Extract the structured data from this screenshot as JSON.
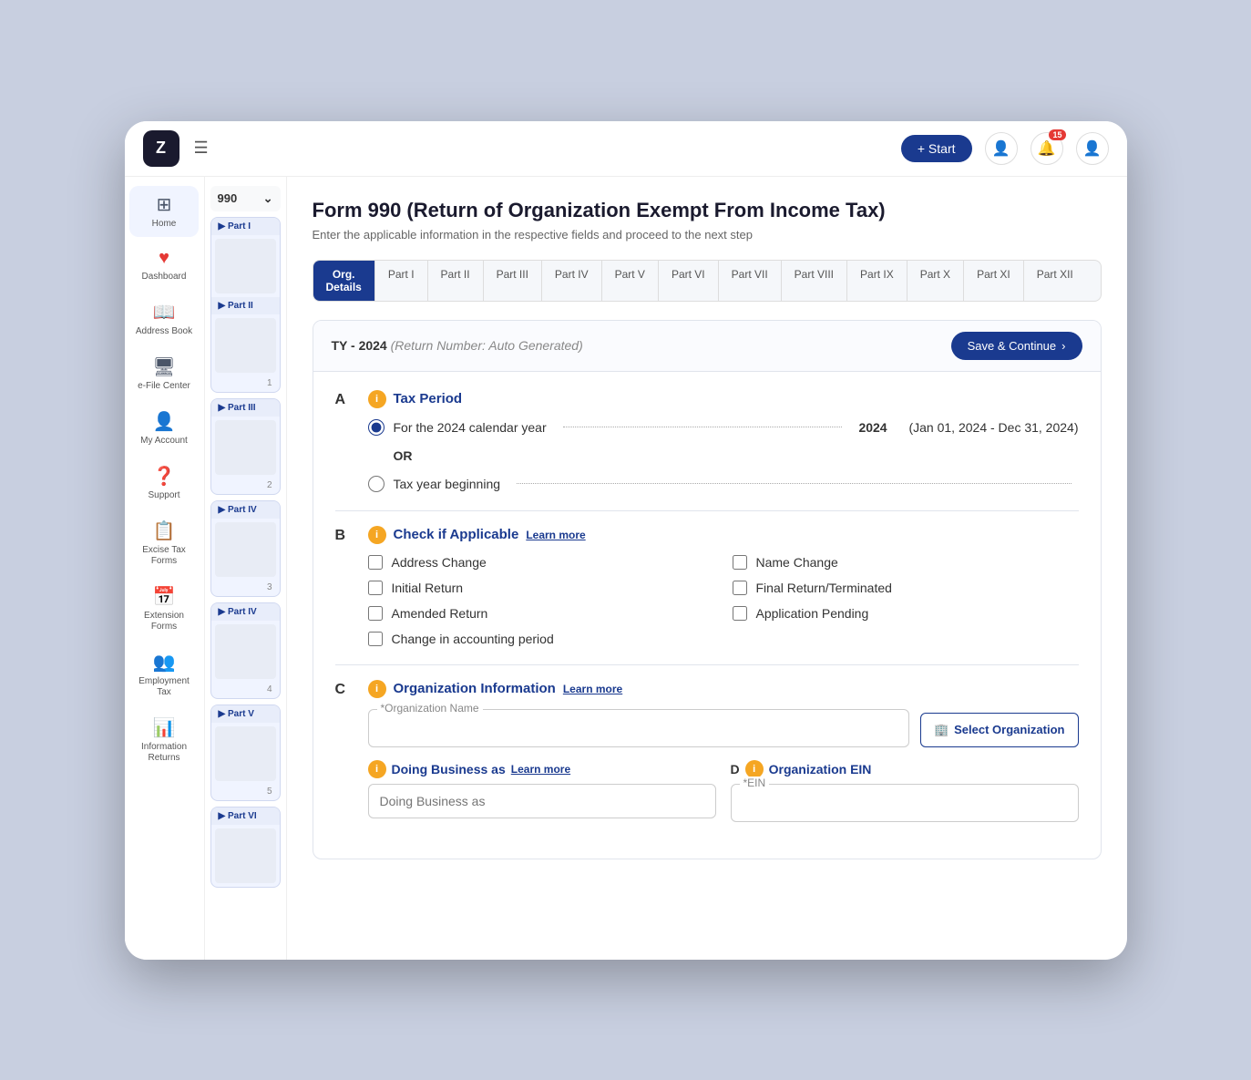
{
  "app": {
    "logo_text": "Z",
    "start_button": "+ Start",
    "notifications_count": "15"
  },
  "sidebar": {
    "items": [
      {
        "id": "home",
        "icon": "⊞",
        "label": "Home"
      },
      {
        "id": "dashboard",
        "icon": "❤",
        "label": "Dashboard"
      },
      {
        "id": "address-book",
        "icon": "📖",
        "label": "Address Book"
      },
      {
        "id": "efile-center",
        "icon": "🖥",
        "label": "e-File Center"
      },
      {
        "id": "my-account",
        "icon": "👤",
        "label": "My Account"
      },
      {
        "id": "support",
        "icon": "❓",
        "label": "Support"
      },
      {
        "id": "excise-tax",
        "icon": "📋",
        "label": "Excise Tax Forms"
      },
      {
        "id": "extension-forms",
        "icon": "📅",
        "label": "Extension Forms"
      },
      {
        "id": "employment-tax",
        "icon": "👥",
        "label": "Employment Tax"
      },
      {
        "id": "information-returns",
        "icon": "📊",
        "label": "Information Returns"
      }
    ]
  },
  "sub_nav": {
    "form_number": "990",
    "sections": [
      "Part I",
      "Part II",
      "Part III",
      "Part IV",
      "Part V",
      "Part VI"
    ]
  },
  "tabs": {
    "items": [
      {
        "id": "org-details",
        "label": "Org.\nDetails",
        "active": true
      },
      {
        "id": "part-1",
        "label": "Part I"
      },
      {
        "id": "part-2",
        "label": "Part II"
      },
      {
        "id": "part-3",
        "label": "Part III"
      },
      {
        "id": "part-4",
        "label": "Part IV"
      },
      {
        "id": "part-5",
        "label": "Part V"
      },
      {
        "id": "part-6",
        "label": "Part VI"
      },
      {
        "id": "part-7",
        "label": "Part VII"
      },
      {
        "id": "part-8",
        "label": "Part VIII"
      },
      {
        "id": "part-9",
        "label": "Part IX"
      },
      {
        "id": "part-10",
        "label": "Part X"
      },
      {
        "id": "part-11",
        "label": "Part XI"
      },
      {
        "id": "part-12",
        "label": "Part XII"
      }
    ]
  },
  "form": {
    "title": "Form 990 (Return of Organization Exempt From Income Tax)",
    "subtitle": "Enter the applicable information in the respective fields and proceed to the next step",
    "return_label": "TY - 2024",
    "return_note": "(Return Number: Auto Generated)",
    "save_continue": "Save & Continue",
    "sections": {
      "a": {
        "letter": "A",
        "title": "Tax Period",
        "calendar_year_label": "For the 2024 calendar year",
        "calendar_year_dots": ". . . . . . . . . . . .",
        "calendar_year_value": "2024",
        "calendar_year_range": "(Jan 01, 2024 - Dec 31, 2024)",
        "or_label": "OR",
        "tax_year_beginning": "Tax year beginning",
        "tax_year_dots": ". . . . . . . . . . . . . . . . . . . . . . . . . . . . . . ."
      },
      "b": {
        "letter": "B",
        "title": "Check if Applicable",
        "learn_more": "Learn more",
        "checkboxes": [
          {
            "id": "address-change",
            "label": "Address Change",
            "col": 1
          },
          {
            "id": "name-change",
            "label": "Name Change",
            "col": 2
          },
          {
            "id": "initial-return",
            "label": "Initial Return",
            "col": 1
          },
          {
            "id": "final-return",
            "label": "Final Return/Terminated",
            "col": 2
          },
          {
            "id": "amended-return",
            "label": "Amended Return",
            "col": 1
          },
          {
            "id": "application-pending",
            "label": "Application Pending",
            "col": 2
          },
          {
            "id": "accounting-period",
            "label": "Change in accounting period",
            "col": "full"
          }
        ]
      },
      "c": {
        "letter": "C",
        "title": "Organization Information",
        "learn_more": "Learn more",
        "org_name_label": "*Organization Name",
        "org_name_placeholder": "",
        "select_org_btn": "Select Organization",
        "doing_business_label": "Doing Business as",
        "doing_business_learn_more": "Learn more",
        "doing_business_placeholder": "Doing Business as"
      },
      "d": {
        "letter": "D",
        "title": "Organization EIN",
        "ein_label": "*EIN"
      }
    }
  },
  "icons": {
    "info": "i",
    "chevron_down": "⌄",
    "chevron_right": "›",
    "building": "🏢",
    "bell": "🔔",
    "user": "👤",
    "menu": "≡",
    "plus": "+",
    "play": "▶"
  }
}
